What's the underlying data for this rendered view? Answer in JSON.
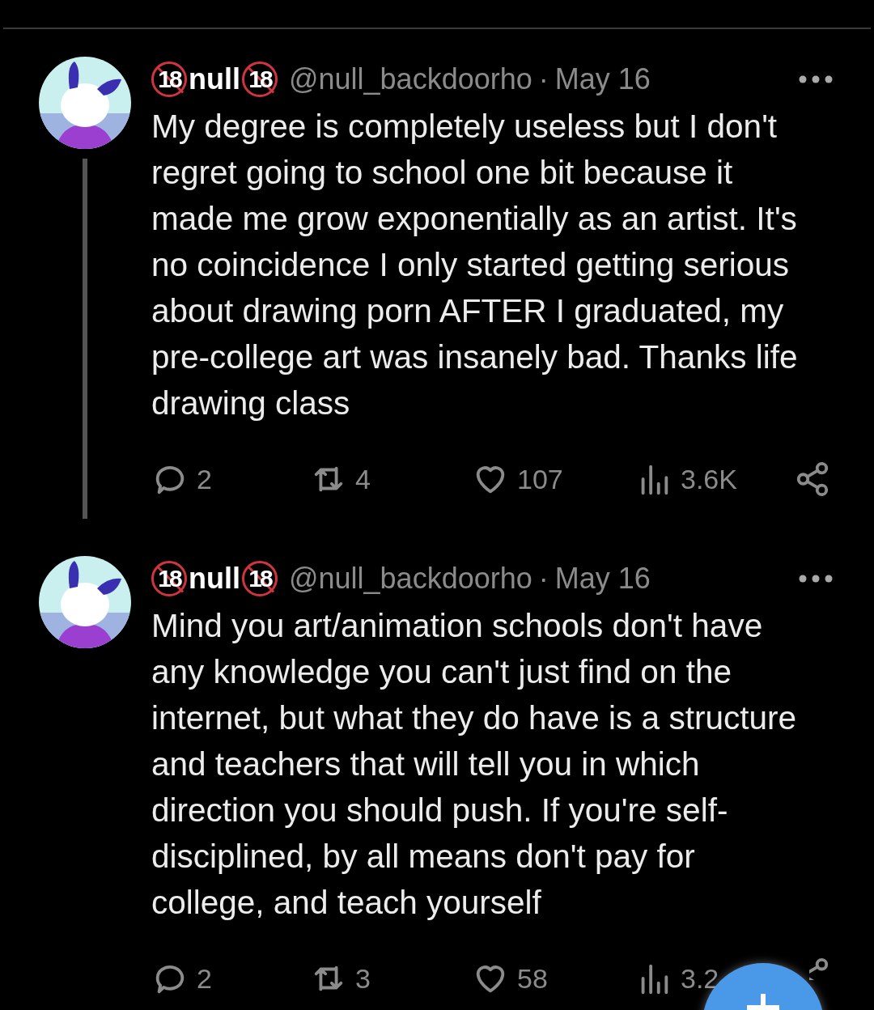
{
  "tweets": [
    {
      "author": {
        "badge_before": "18",
        "name": "null",
        "badge_after": "18"
      },
      "handle": "@null_backdoorho",
      "separator": "·",
      "date": "May 16",
      "text": "My degree is completely useless but I don't regret going to school one bit because it made me grow exponentially as an artist. It's no coincidence I only started getting serious about drawing porn AFTER I graduated, my pre-college art was insanely bad. Thanks life drawing class",
      "thread_line": true,
      "stats": {
        "replies": "2",
        "reposts": "4",
        "likes": "107",
        "views": "3.6K"
      }
    },
    {
      "author": {
        "badge_before": "18",
        "name": "null",
        "badge_after": "18"
      },
      "handle": "@null_backdoorho",
      "separator": "·",
      "date": "May 16",
      "text": "Mind you art/animation schools don't have any knowledge you can't just find on the internet, but what they do have is a structure and teachers that will tell you in which direction you should push. If you're self-disciplined, by all means don't pay for college, and teach yourself",
      "thread_line": false,
      "stats": {
        "replies": "2",
        "reposts": "3",
        "likes": "58",
        "views": "3.2"
      }
    }
  ],
  "compose_button": {
    "visible": true
  }
}
